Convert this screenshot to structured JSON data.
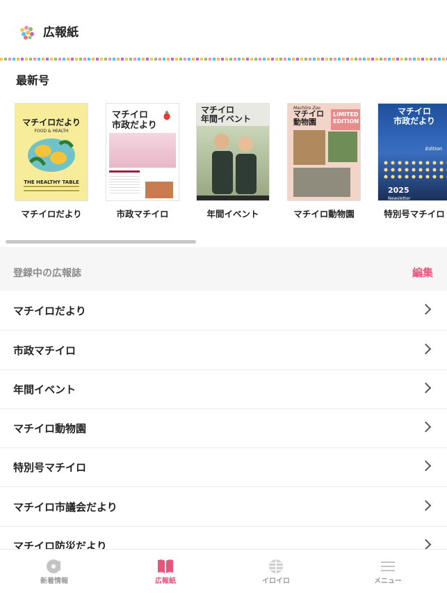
{
  "header": {
    "title": "広報紙"
  },
  "latest": {
    "title": "最新号",
    "items": [
      {
        "label": "マチイロだより",
        "cover_title": "マチイロだより",
        "cover_sub": "FOOD & HEALTH",
        "cover_footer": "THE HEALTHY TABLE"
      },
      {
        "label": "市政マチイロ",
        "cover_title": "マチイロ",
        "cover_title2": "市政だより"
      },
      {
        "label": "年間イベント",
        "cover_title": "マチイロ",
        "cover_title2": "年間イベント"
      },
      {
        "label": "マチイロ動物園",
        "cover_title": "マチイロ",
        "cover_title2": "動物園",
        "cover_badge": "LIMITED EDITION",
        "cover_script": "Machiiro Zoo"
      },
      {
        "label": "特別号マチイロ",
        "cover_title": "マチイロ",
        "cover_title2": "市政だより",
        "cover_year": "2025",
        "cover_tag": "Edition",
        "cover_tag2": "Newsletter"
      }
    ]
  },
  "registered": {
    "title": "登録中の広報誌",
    "edit_label": "編集",
    "items": [
      {
        "label": "マチイロだより"
      },
      {
        "label": "市政マチイロ"
      },
      {
        "label": "年間イベント"
      },
      {
        "label": "マチイロ動物園"
      },
      {
        "label": "特別号マチイロ"
      },
      {
        "label": "マチイロ市議会だより"
      },
      {
        "label": "マチイロ防災だより"
      }
    ]
  },
  "nav": {
    "items": [
      {
        "label": "新着情報",
        "icon": "disc-icon"
      },
      {
        "label": "広報紙",
        "icon": "book-icon",
        "active": true
      },
      {
        "label": "イロイロ",
        "icon": "globe-icon"
      },
      {
        "label": "メニュー",
        "icon": "menu-icon"
      }
    ]
  },
  "colors": {
    "accent": "#e8547b",
    "muted": "#9a9a9a"
  }
}
